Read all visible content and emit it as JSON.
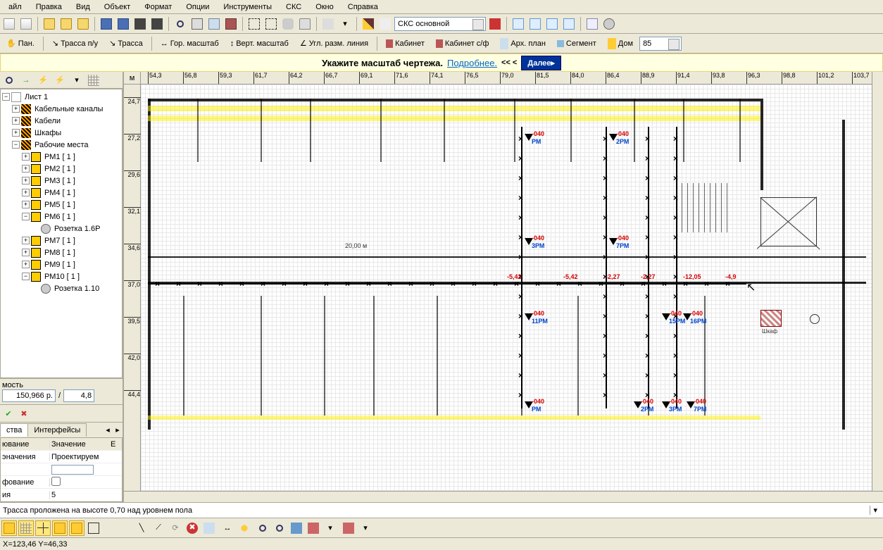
{
  "menu": [
    "айл",
    "Правка",
    "Вид",
    "Объект",
    "Формат",
    "Опции",
    "Инструменты",
    "СКС",
    "Окно",
    "Справка"
  ],
  "toolbar2": {
    "pan": "Пан.",
    "trace_pu": "Трасса п/у",
    "trace": "Трасса",
    "hscale": "Гор. масштаб",
    "vscale": "Верт. масштаб",
    "angdim": "Угл. разм. линия",
    "cabinet": "Кабинет",
    "cabinet_sf": "Кабинет с/ф",
    "archplan": "Арх. план",
    "segment": "Сегмент",
    "house": "Дом",
    "house_combo": "85"
  },
  "main_combo": "СКС основной",
  "hint": {
    "text": "Укажите масштаб чертежа.",
    "link": "Подробнее.",
    "arrows": "<< <",
    "next": "Далее▸"
  },
  "tree": {
    "root": "Лист 1",
    "groups": [
      {
        "label": "Кабельные каналы",
        "exp": "+"
      },
      {
        "label": "Кабели",
        "exp": "+"
      },
      {
        "label": "Шкафы",
        "exp": "+"
      },
      {
        "label": "Рабочие места",
        "exp": "−",
        "children": [
          {
            "label": "РМ1  [ 1 ]",
            "exp": "+"
          },
          {
            "label": "РМ2  [ 1 ]",
            "exp": "+"
          },
          {
            "label": "РМ3  [ 1 ]",
            "exp": "+"
          },
          {
            "label": "РМ4  [ 1 ]",
            "exp": "+"
          },
          {
            "label": "РМ5  [ 1 ]",
            "exp": "+"
          },
          {
            "label": "РМ6  [ 1 ]",
            "exp": "−",
            "children": [
              {
                "label": "Розетка 1.6Р"
              }
            ]
          },
          {
            "label": "РМ7  [ 1 ]",
            "exp": "+"
          },
          {
            "label": "РМ8  [ 1 ]",
            "exp": "+"
          },
          {
            "label": "РМ9  [ 1 ]",
            "exp": "+"
          },
          {
            "label": "РМ10  [ 1 ]",
            "exp": "−",
            "children": [
              {
                "label": "Розетка 1.10"
              }
            ]
          }
        ]
      }
    ]
  },
  "cost": {
    "label": "мость",
    "value": "150,966 p.",
    "sep": "/",
    "value2": "4,8"
  },
  "tabs": {
    "t1": "ства",
    "t2": "Интерфейсы"
  },
  "props": {
    "h1": "ювание",
    "h2": "Значение",
    "h3": "Е",
    "rows": [
      {
        "n": "эначения",
        "v": "Проектируем"
      },
      {
        "n": "",
        "v": ""
      },
      {
        "n": "фование",
        "v": ""
      },
      {
        "n": "ия",
        "v": "5"
      }
    ]
  },
  "ruler": {
    "corner": "м",
    "h": [
      "54,3",
      "56,8",
      "59,3",
      "61,7",
      "64,2",
      "66,7",
      "69,1",
      "71,6",
      "74,1",
      "76,5",
      "79,0",
      "81,5",
      "84,0",
      "86,4",
      "88,9",
      "91,4",
      "93,8",
      "96,3",
      "98,8",
      "101,2",
      "103,7"
    ],
    "v": [
      "24,7",
      "27,2",
      "29,6",
      "32,1",
      "34,6",
      "37,0",
      "39,5",
      "42,0",
      "44,4"
    ]
  },
  "drawing": {
    "dim_label": "20,00  м",
    "outlets": [
      {
        "blue": "РМ",
        "red": "-040"
      },
      {
        "blue": "2РМ",
        "red": "-040"
      },
      {
        "blue": "3РМ",
        "red": "-040"
      },
      {
        "blue": "7РМ",
        "red": "-040"
      },
      {
        "blue": "11РМ",
        "red": "-040"
      },
      {
        "blue": "15РМ",
        "red": "-040"
      },
      {
        "blue": "16РМ",
        "red": "-040"
      }
    ],
    "cab_label": "Шкаф",
    "trace_dims": [
      "-5,42",
      "-5,42",
      "-2,27",
      "-2,27",
      "-12,05",
      "-4,9"
    ]
  },
  "status_msg": "Трасса проложена на высоте 0,70 над уровнем пола",
  "coords": "X=123,46  Y=46,33"
}
